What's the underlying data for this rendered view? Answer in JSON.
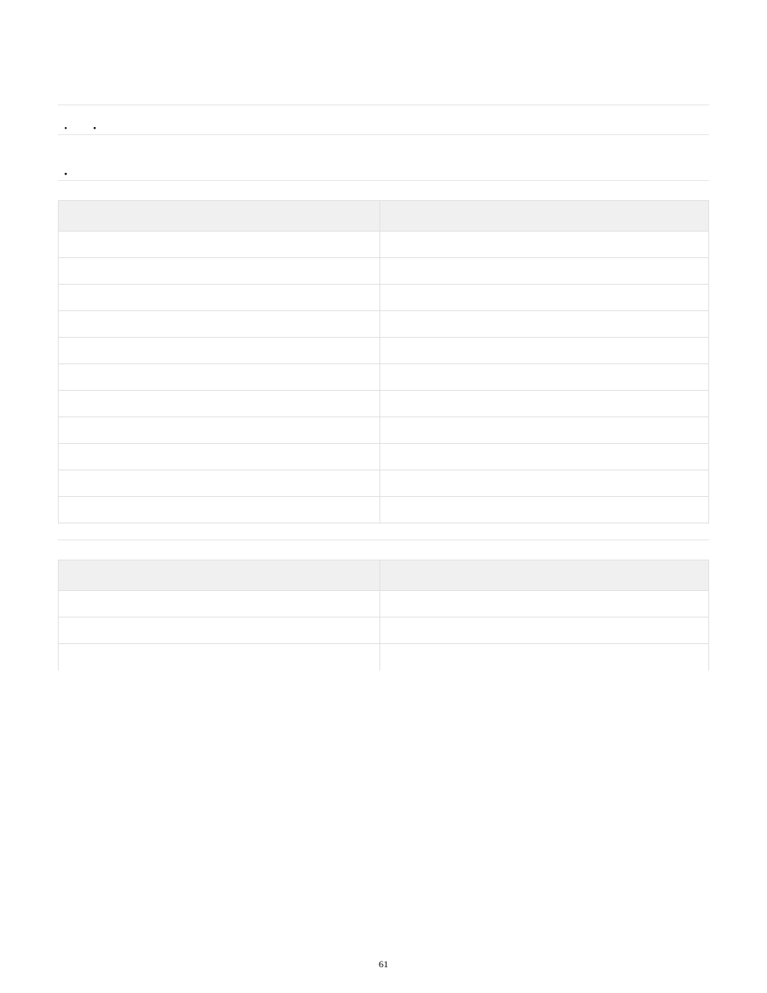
{
  "page_number": "61",
  "sections": [
    {
      "type": "list",
      "items": [
        {
          "text": "",
          "children": [
            {
              "text": ""
            },
            {
              "text": ""
            }
          ]
        }
      ]
    },
    {
      "type": "list",
      "items": [
        {
          "text": ""
        },
        {
          "text": ""
        },
        {
          "text": ""
        },
        {
          "text": ""
        },
        {
          "text": ""
        }
      ]
    },
    {
      "type": "table",
      "headers": [
        "",
        ""
      ],
      "rows": [
        [
          "",
          ""
        ],
        [
          "",
          ""
        ],
        [
          "",
          ""
        ],
        [
          "",
          ""
        ],
        [
          "",
          ""
        ],
        [
          "",
          ""
        ],
        [
          "",
          ""
        ],
        [
          "",
          ""
        ],
        [
          "",
          ""
        ],
        [
          "",
          ""
        ],
        [
          "",
          ""
        ]
      ]
    },
    {
      "type": "table",
      "headers": [
        "",
        ""
      ],
      "rows": [
        [
          "",
          ""
        ],
        [
          "",
          ""
        ],
        [
          "",
          ""
        ]
      ]
    }
  ]
}
